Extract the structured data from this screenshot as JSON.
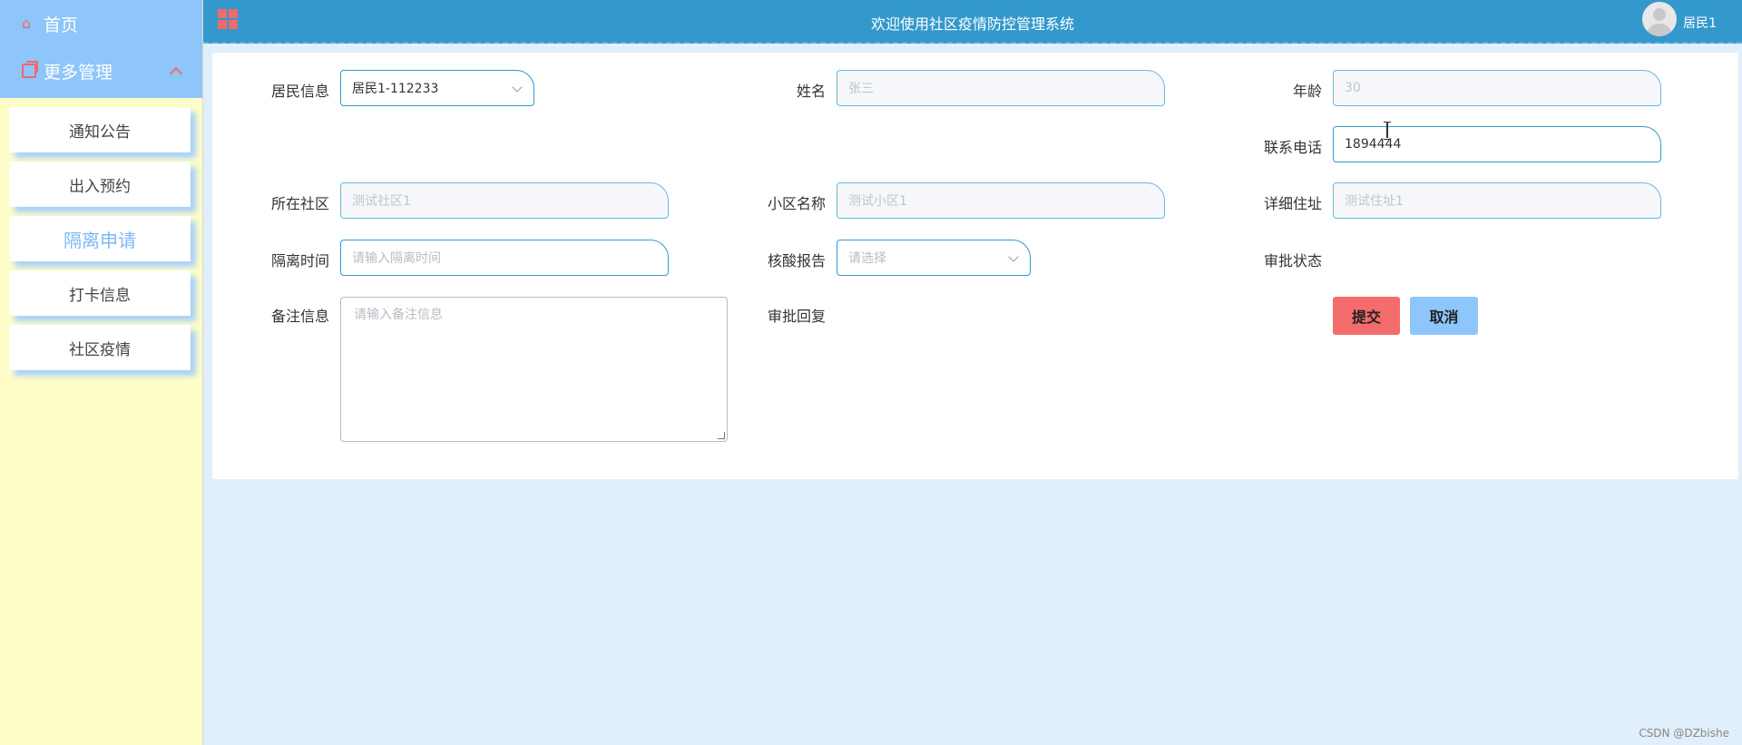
{
  "sidebar": {
    "home_label": "首页",
    "more_label": "更多管理",
    "items": [
      {
        "label": "通知公告"
      },
      {
        "label": "出入预约"
      },
      {
        "label": "隔离申请"
      },
      {
        "label": "打卡信息"
      },
      {
        "label": "社区疫情"
      }
    ],
    "active_item": "隔离申请"
  },
  "header": {
    "title": "欢迎使用社区疫情防控管理系统",
    "user_name": "居民1"
  },
  "form": {
    "resident_info": {
      "label": "居民信息",
      "value": "居民1-112233"
    },
    "name": {
      "label": "姓名",
      "value": "张三"
    },
    "age": {
      "label": "年龄",
      "value": "30"
    },
    "phone": {
      "label": "联系电话",
      "value": "1894444"
    },
    "community": {
      "label": "所在社区",
      "value": "测试社区1"
    },
    "estate_name": {
      "label": "小区名称",
      "value": "测试小区1"
    },
    "address": {
      "label": "详细住址",
      "value": "测试住址1"
    },
    "isolation_time": {
      "label": "隔离时间",
      "placeholder": "请输入隔离时间"
    },
    "nucleic_report": {
      "label": "核酸报告",
      "placeholder": "请选择"
    },
    "approval_status": {
      "label": "审批状态"
    },
    "remarks": {
      "label": "备注信息",
      "placeholder": "请输入备注信息"
    },
    "approval_reply": {
      "label": "审批回复"
    },
    "submit_label": "提交",
    "cancel_label": "取消"
  },
  "watermark": "CSDN @DZbishe",
  "colors": {
    "topbar": "#3399cc",
    "sidebar_top": "#8ec5fa",
    "sidebar_bg": "#fefdc8",
    "accent_red": "#f56c6c",
    "page_bg": "#e1eefb"
  }
}
